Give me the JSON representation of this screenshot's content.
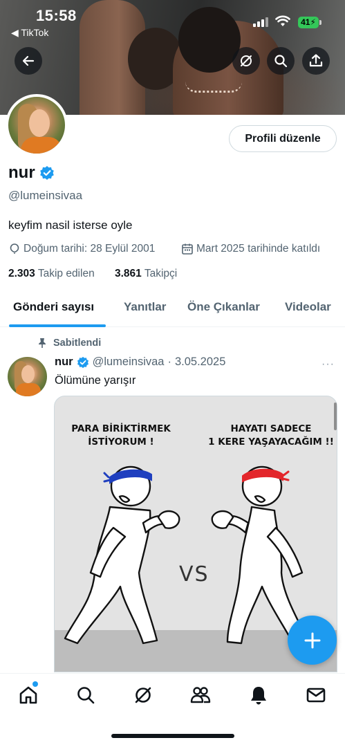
{
  "status_bar": {
    "time": "15:58",
    "back_app": "◀ TikTok",
    "battery": "41"
  },
  "header_buttons": {
    "back_icon": "arrow-left-icon",
    "grok_icon": "grok-icon",
    "search_icon": "search-icon",
    "share_icon": "share-icon"
  },
  "profile": {
    "edit_label": "Profili düzenle",
    "name": "nur",
    "verified": true,
    "handle": "@lumeinsivaa",
    "bio": "keyfim nasil isterse oyle",
    "birthday": "Doğum tarihi: 28 Eylül 2001",
    "joined": "Mart 2025 tarihinde katıldı",
    "following_count": "2.303",
    "following_label": "Takip edilen",
    "followers_count": "3.861",
    "followers_label": "Takipçi"
  },
  "tabs": [
    {
      "label": "Gönderi sayısı",
      "active": true
    },
    {
      "label": "Yanıtlar",
      "active": false
    },
    {
      "label": "Öne Çıkanlar",
      "active": false
    },
    {
      "label": "Videolar",
      "active": false
    }
  ],
  "post": {
    "pinned_label": "Sabitlendi",
    "author_name": "nur",
    "author_handle": "@lumeinsivaa",
    "separator": "·",
    "date": "3.05.2025",
    "text": "Ölümüne yarışır",
    "more": "···",
    "image": {
      "caption_left_1": "PARA BİRİKTİRMEK",
      "caption_left_2": "İSTİYORUM !",
      "caption_right_1": "HAYATI SADECE",
      "caption_right_2": "1 KERE YAŞAYACAĞIM !!",
      "vs": "VS",
      "left_headband_color": "#1f3fbf",
      "right_headband_color": "#e3262b"
    }
  },
  "bottom_nav": [
    "home-icon",
    "search-icon",
    "grok-icon",
    "communities-icon",
    "notifications-icon",
    "messages-icon"
  ],
  "colors": {
    "accent": "#1d9bf0",
    "text_primary": "#0f1419",
    "text_secondary": "#536471",
    "battery": "#34c759"
  }
}
